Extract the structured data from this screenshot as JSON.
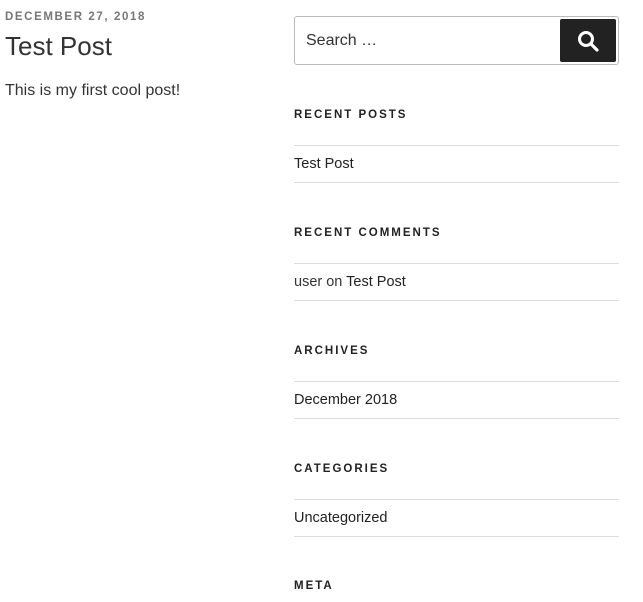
{
  "post": {
    "date": "December 27, 2018",
    "title": "Test Post",
    "content": "This is my first cool post!"
  },
  "search": {
    "placeholder": "Search …",
    "button_icon": "search-icon"
  },
  "widgets": {
    "recent_posts": {
      "title": "Recent Posts",
      "items": [
        "Test Post"
      ]
    },
    "recent_comments": {
      "title": "Recent Comments",
      "author": "user",
      "connector": " on ",
      "post": "Test Post"
    },
    "archives": {
      "title": "Archives",
      "items": [
        "December 2018"
      ]
    },
    "categories": {
      "title": "Categories",
      "items": [
        "Uncategorized"
      ]
    },
    "meta": {
      "title": "Meta"
    }
  },
  "colors": {
    "search_button_bg": "#222222",
    "divider": "#dddddd",
    "date_text": "#767676"
  }
}
